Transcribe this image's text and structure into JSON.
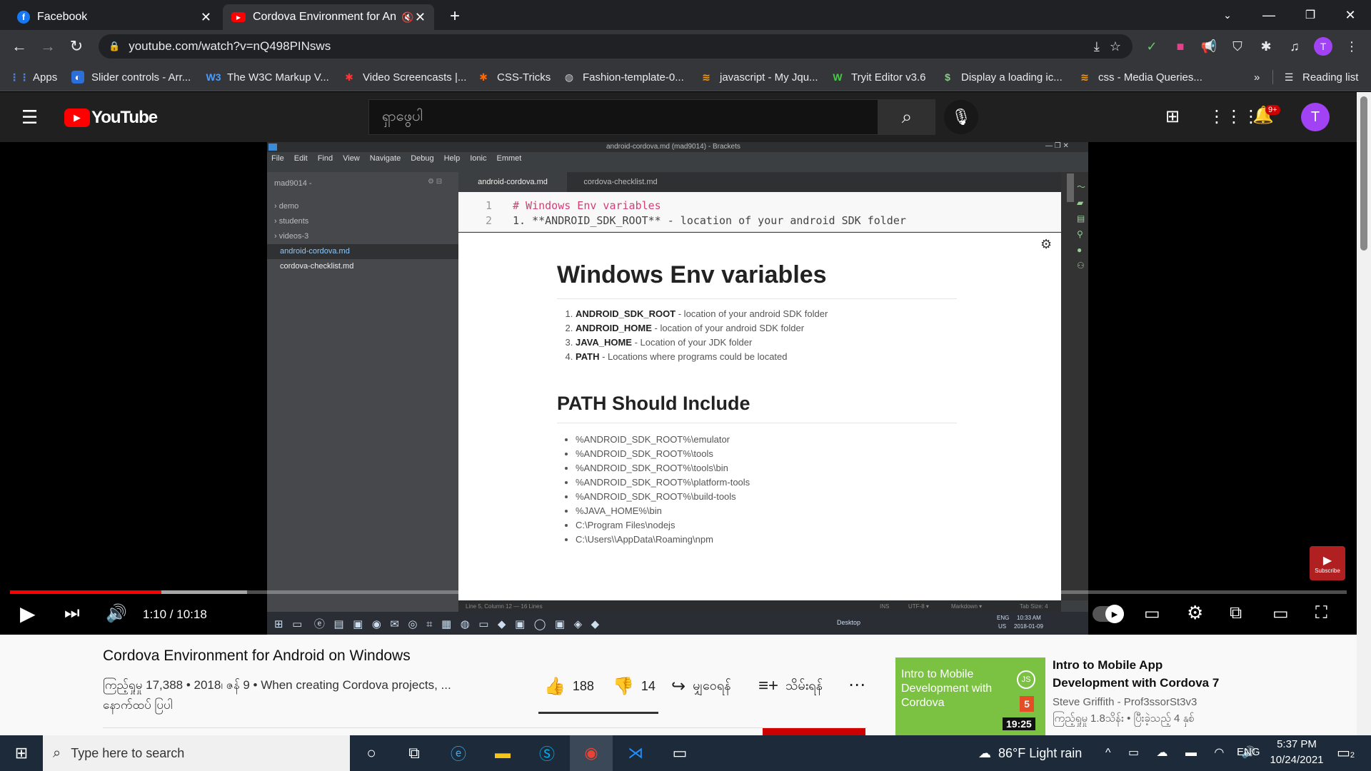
{
  "browser": {
    "tabs": [
      {
        "title": "Facebook",
        "close": "✕"
      },
      {
        "title": "Cordova Environment for An",
        "close": "✕"
      }
    ],
    "new_tab": "+",
    "url": "youtube.com/watch?v=nQ498PINsws",
    "bookmarks": [
      {
        "label": "Apps"
      },
      {
        "label": "Slider controls - Arr..."
      },
      {
        "label": "The W3C Markup V..."
      },
      {
        "label": "Video Screencasts |..."
      },
      {
        "label": "CSS-Tricks"
      },
      {
        "label": "Fashion-template-0..."
      },
      {
        "label": "javascript - My Jqu..."
      },
      {
        "label": "Tryit Editor v3.6"
      },
      {
        "label": "Display a loading ic..."
      },
      {
        "label": "css - Media Queries..."
      }
    ],
    "more_bookmarks": "»",
    "reading_list": "Reading list",
    "profile_initial": "T"
  },
  "youtube": {
    "logo": "YouTube",
    "search_placeholder": "ရှာဖွေပါ",
    "notif_badge": "9+",
    "avatar": "T",
    "video": {
      "time": "1:10 / 10:18",
      "progress": 0.113,
      "subscribe_label": "Subscribe",
      "editor": {
        "window_title": "android-cordova.md (mad9014) - Brackets",
        "menu": [
          "File",
          "Edit",
          "Find",
          "View",
          "Navigate",
          "Debug",
          "Help",
          "Ionic",
          "Emmet"
        ],
        "project": "mad9014 -",
        "tree": [
          "› demo",
          "› students",
          "› videos-3",
          "android-cordova.md",
          "cordova-checklist.md"
        ],
        "tabs": [
          "android-cordova.md",
          "cordova-checklist.md"
        ],
        "code_lines": [
          {
            "n": "1",
            "text": "# Windows Env variables"
          },
          {
            "n": "2",
            "text": "1. **ANDROID_SDK_ROOT** - location of your android SDK folder"
          }
        ],
        "preview": {
          "h1": "Windows Env variables",
          "env": [
            {
              "k": "ANDROID_SDK_ROOT",
              "v": " - location of your android SDK folder"
            },
            {
              "k": "ANDROID_HOME",
              "v": " - location of your android SDK folder"
            },
            {
              "k": "JAVA_HOME",
              "v": " - Location of your JDK folder"
            },
            {
              "k": "PATH",
              "v": " - Locations where programs could be located"
            }
          ],
          "h2": "PATH Should Include",
          "paths": [
            "%ANDROID_SDK_ROOT%\\emulator",
            "%ANDROID_SDK_ROOT%\\tools",
            "%ANDROID_SDK_ROOT%\\tools\\bin",
            "%ANDROID_SDK_ROOT%\\platform-tools",
            "%ANDROID_SDK_ROOT%\\build-tools",
            "%JAVA_HOME%\\bin",
            "C:\\Program Files\\nodejs",
            "C:\\Users\\\\AppData\\Roaming\\npm"
          ]
        },
        "status": {
          "pos": "Line 5, Column 12 — 16 Lines",
          "ins": "INS",
          "enc": "UTF-8 ▾",
          "mode": "Markdown ▾",
          "tab": "Tab Size: 4"
        },
        "inner_taskbar": {
          "desktop": "Desktop",
          "lang": "ENG",
          "region": "US",
          "time": "10:33 AM",
          "date": "2018-01-09"
        }
      }
    },
    "title": "Cordova Environment for Android on Windows",
    "meta": "ကြည့်ရှုမှု 17,388 • 2018၊ ဇန် 9 • When creating Cordova projects, ...",
    "more": "နောက်ထပ် ပြပါ",
    "likes": "188",
    "dislikes": "14",
    "share": "မျှဝေရန်",
    "save": "သိမ်းရန်",
    "recommend": {
      "thumb_text": "Intro to Mobile Development with Cordova",
      "duration": "19:25",
      "title": "Intro to Mobile App Development with Cordova 7",
      "channel": "Steve Griffith - Prof3ssorSt3v3",
      "meta": "ကြည့်ရှုမှု 1.8သိန်း • ပြီးခဲ့သည့် 4 နှစ်"
    }
  },
  "taskbar": {
    "search": "Type here to search",
    "weather": "86°F  Light rain",
    "lang": "ENG",
    "time": "5:37 PM",
    "date": "10/24/2021",
    "notif": "2"
  },
  "colors": {
    "youtube_red": "#ff0000",
    "chrome_dark": "#202124",
    "taskbar": "#1c2a3a"
  }
}
